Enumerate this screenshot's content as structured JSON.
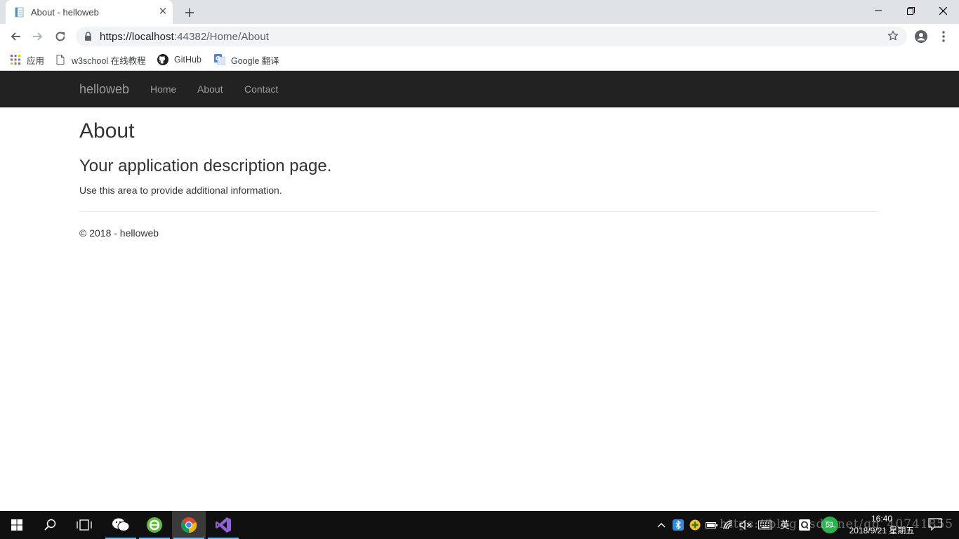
{
  "browser": {
    "tab_title": "About - helloweb",
    "new_tab_icon": "plus-icon",
    "url_host": "https://localhost",
    "url_rest": ":44382/Home/About"
  },
  "bookmarks": [
    {
      "label": "应用",
      "icon": "apps-grid-icon"
    },
    {
      "label": "w3school 在线教程",
      "icon": "page-icon"
    },
    {
      "label": "GitHub",
      "icon": "github-icon"
    },
    {
      "label": "Google 翻译",
      "icon": "google-translate-icon"
    }
  ],
  "site": {
    "brand": "helloweb",
    "nav": [
      "Home",
      "About",
      "Contact"
    ],
    "heading": "About",
    "subheading": "Your application description page.",
    "body": "Use this area to provide additional information.",
    "footer": "© 2018 - helloweb"
  },
  "taskbar": {
    "time": "16:40",
    "date": "2018/9/21 星期五",
    "ime": "英",
    "badge": "51",
    "watermark": "https://blog.csdn.net/qq_40741855"
  },
  "colors": {
    "navbar_bg": "#222222",
    "nav_text": "#9d9d9d",
    "taskbar_bg": "#101010",
    "tabstrip_bg": "#dee1e6"
  }
}
